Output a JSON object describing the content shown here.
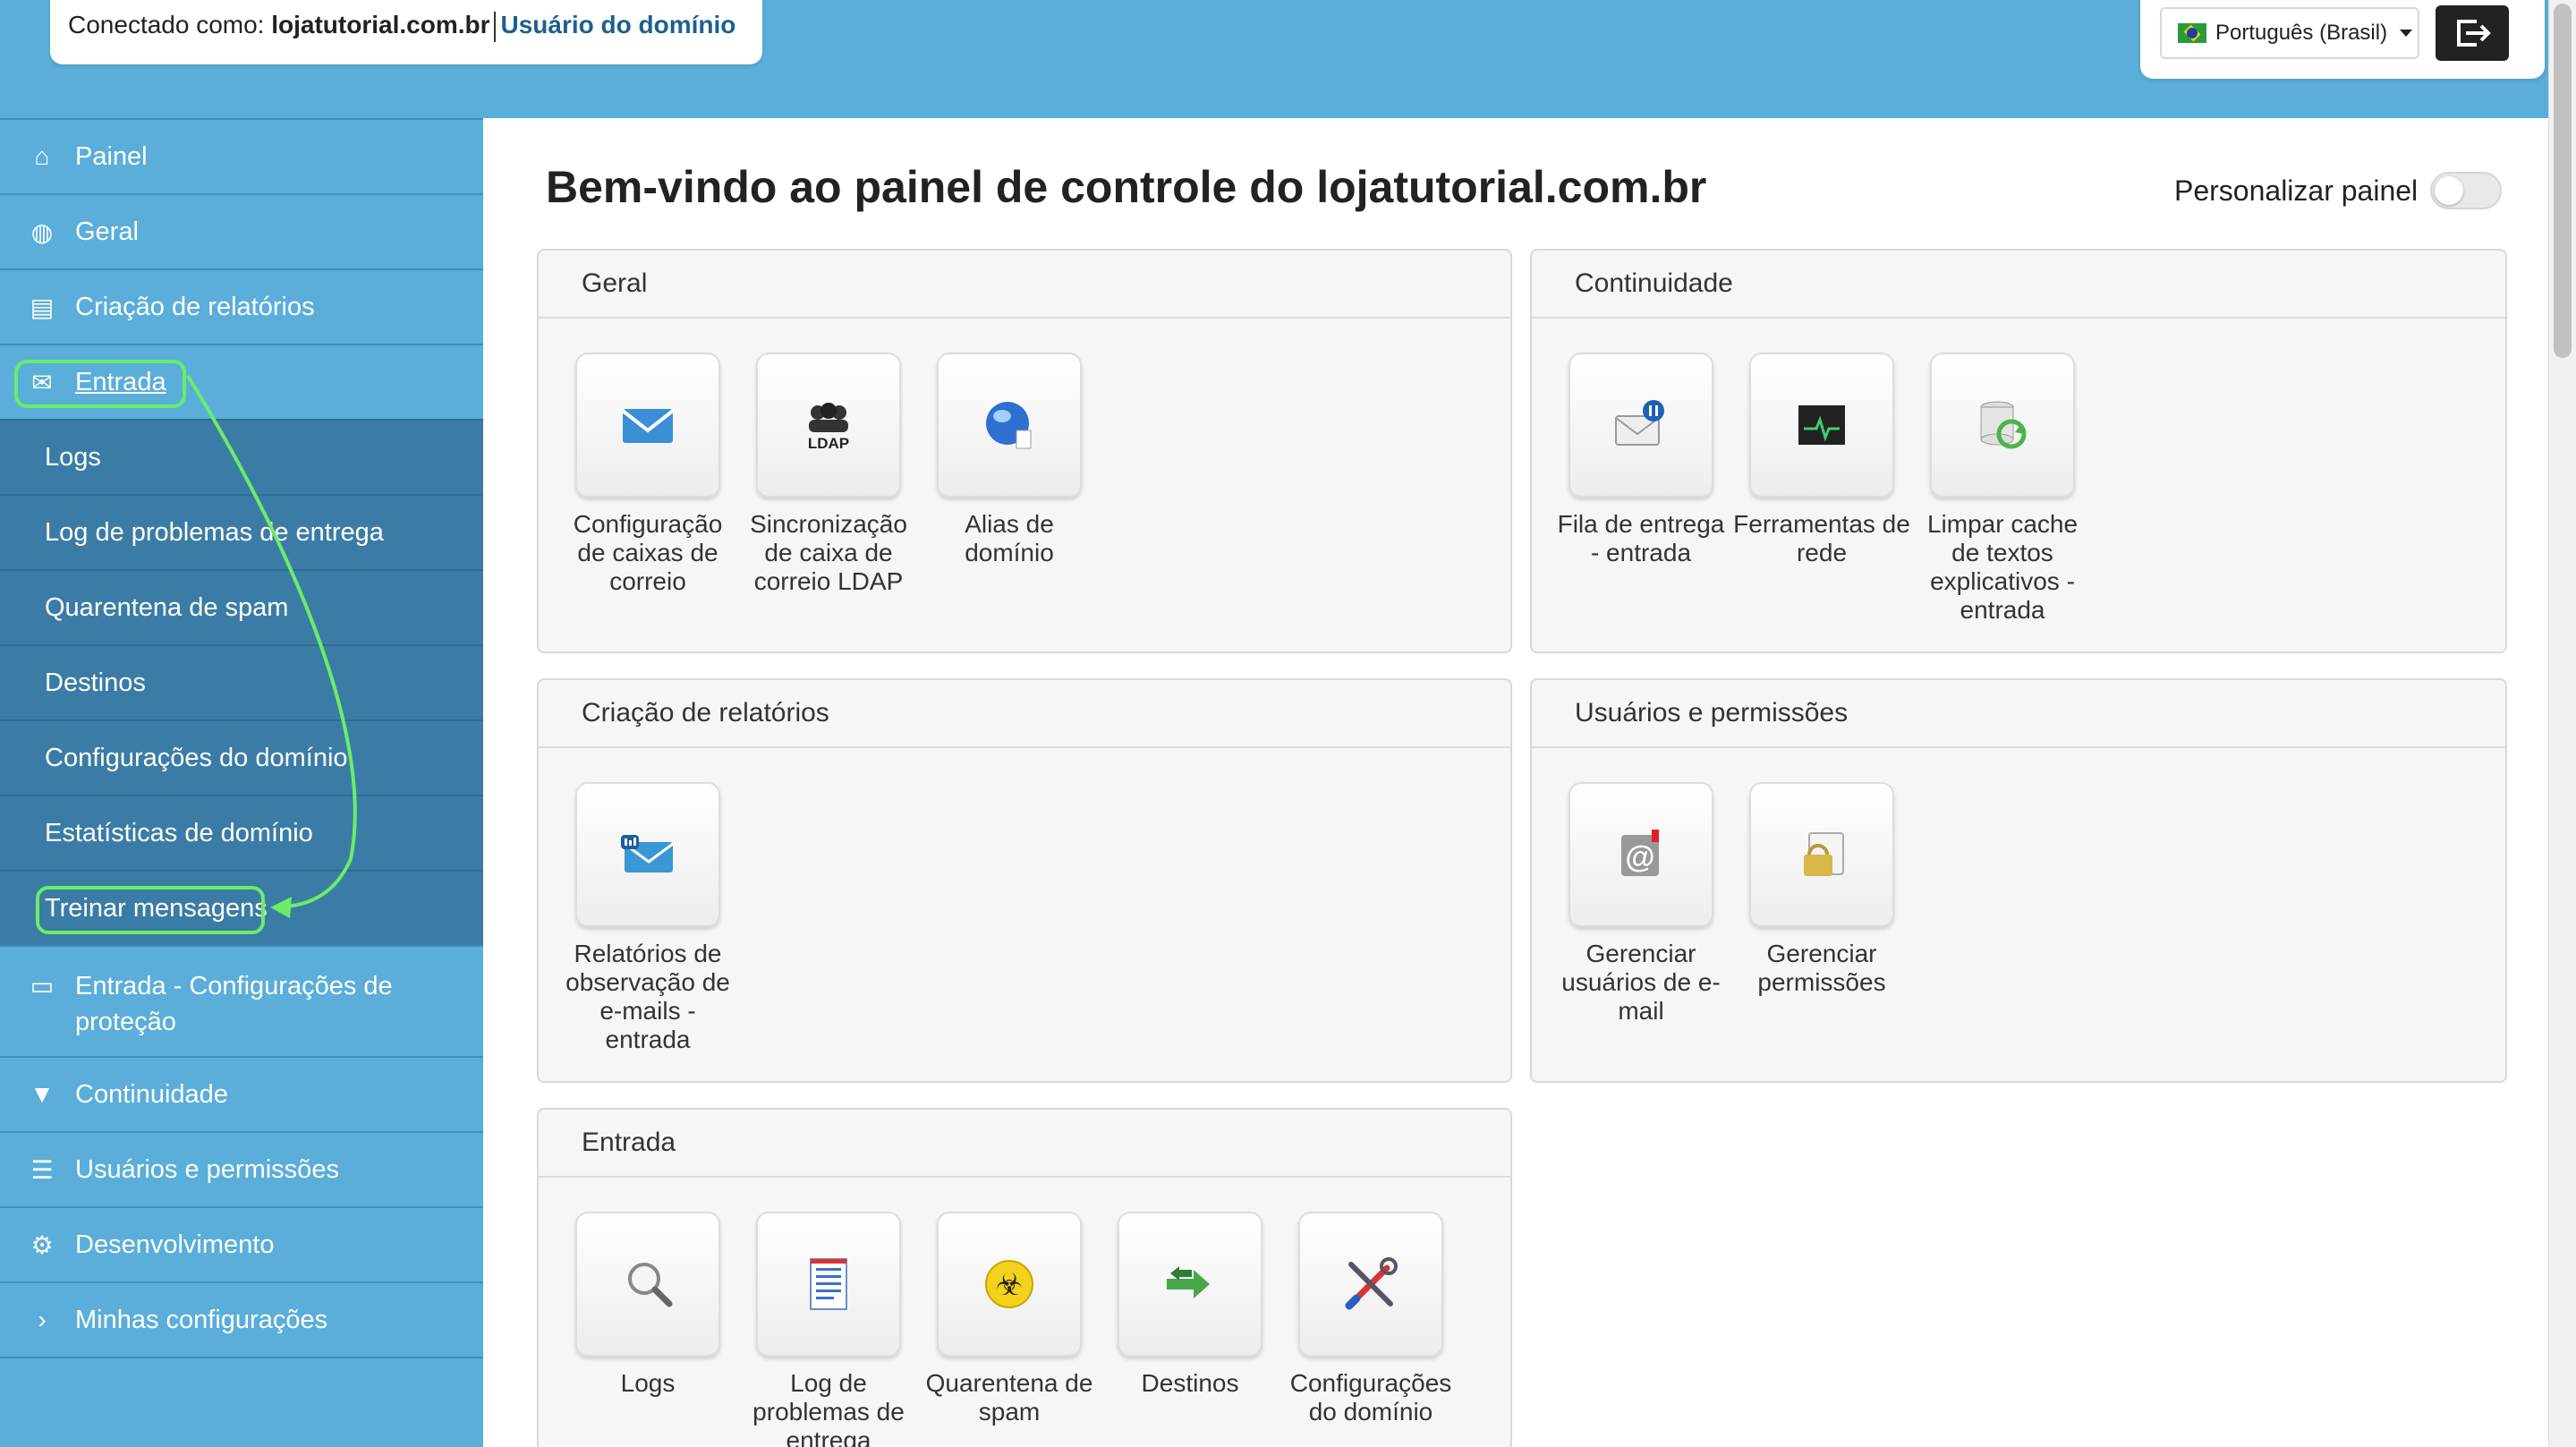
{
  "header": {
    "connected_label": "Conectado como:",
    "domain": "lojatutorial.com.br",
    "role": "Usuário do domínio",
    "language": "Português (Brasil)"
  },
  "sidebar": {
    "items": [
      {
        "label": "Painel",
        "icon": "home-icon"
      },
      {
        "label": "Geral",
        "icon": "globe-icon"
      },
      {
        "label": "Criação de relatórios",
        "icon": "inbox-icon"
      },
      {
        "label": "Entrada",
        "icon": "envelope-icon",
        "expanded": true
      },
      {
        "label": "Entrada - Configurações de proteção",
        "icon": "folder-open-icon"
      },
      {
        "label": "Continuidade",
        "icon": "filter-icon"
      },
      {
        "label": "Usuários e permissões",
        "icon": "list-icon"
      },
      {
        "label": "Desenvolvimento",
        "icon": "gear-icon"
      },
      {
        "label": "Minhas configurações",
        "icon": "chevron-right-icon"
      }
    ],
    "entrada_subitems": [
      "Logs",
      "Log de problemas de entrega",
      "Quarentena de spam",
      "Destinos",
      "Configurações do domínio",
      "Estatísticas de domínio",
      "Treinar mensagens"
    ]
  },
  "main": {
    "title": "Bem-vindo ao painel de controle do lojatutorial.com.br",
    "customize_label": "Personalizar painel",
    "panels": {
      "geral": {
        "title": "Geral",
        "tiles": [
          {
            "label": "Configuração de caixas de correio",
            "icon": "mailbox-envelope-icon"
          },
          {
            "label": "Sincronização de caixa de correio LDAP",
            "icon": "ldap-users-icon"
          },
          {
            "label": "Alias de domínio",
            "icon": "globe-alias-icon"
          }
        ]
      },
      "continuidade": {
        "title": "Continuidade",
        "tiles": [
          {
            "label": "Fila de entrega - entrada",
            "icon": "mail-pause-icon"
          },
          {
            "label": "Ferramentas de rede",
            "icon": "network-monitor-icon"
          },
          {
            "label": "Limpar cache de textos explicativos - entrada",
            "icon": "database-refresh-icon"
          }
        ]
      },
      "relatorios": {
        "title": "Criação de relatórios",
        "tiles": [
          {
            "label": "Relatórios de observação de e-mails - entrada",
            "icon": "mail-report-icon"
          }
        ]
      },
      "usuarios": {
        "title": "Usuários e permissões",
        "tiles": [
          {
            "label": "Gerenciar usuários de e-mail",
            "icon": "at-user-icon"
          },
          {
            "label": "Gerenciar permissões",
            "icon": "lock-permissions-icon"
          }
        ]
      },
      "entrada": {
        "title": "Entrada",
        "tiles": [
          {
            "label": "Logs",
            "icon": "magnifier-icon"
          },
          {
            "label": "Log de problemas de entrega",
            "icon": "document-log-icon"
          },
          {
            "label": "Quarentena de spam",
            "icon": "biohazard-icon"
          },
          {
            "label": "Destinos",
            "icon": "arrows-swap-icon"
          },
          {
            "label": "Configurações do domínio",
            "icon": "tools-icon"
          }
        ]
      }
    }
  },
  "colors": {
    "sidebar": "#5aaed9",
    "sidebar_sub": "#3b7ca6",
    "highlight": "#6cec68"
  }
}
